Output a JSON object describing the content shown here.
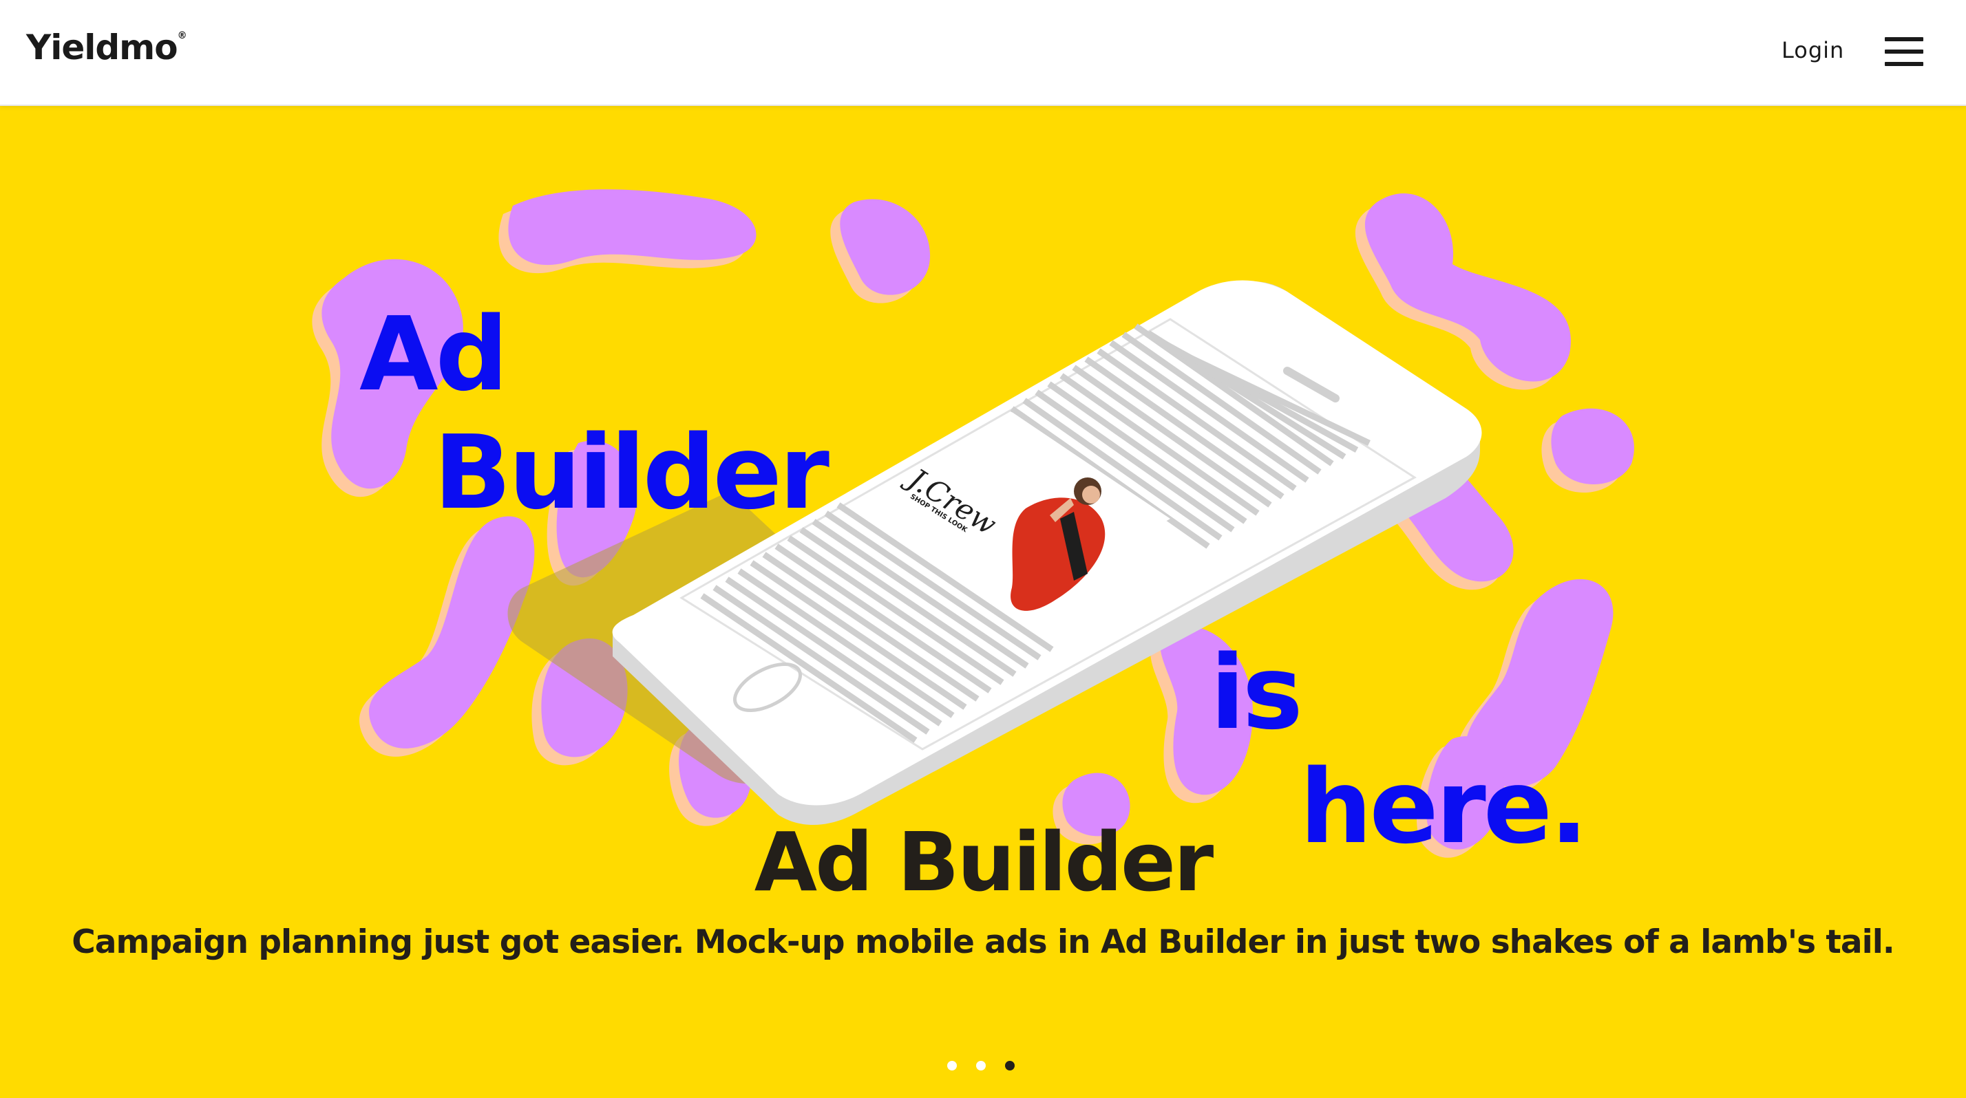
{
  "header": {
    "logo": "Yieldmo",
    "logo_mark": "®",
    "login_label": "Login",
    "menu_icon": "hamburger-menu-icon"
  },
  "hero": {
    "background_color": "#ffdb00",
    "art": {
      "line1": "Ad",
      "line2": "Builder",
      "line3": "is",
      "line4": "here.",
      "phone_ad_brand": "J.Crew",
      "phone_ad_cta": "SHOP THIS LOOK",
      "accent_color": "#0b0df2",
      "blob_color": "#d98aff"
    },
    "title": "Ad Builder",
    "subtitle": "Campaign planning just got easier. Mock-up mobile ads in Ad Builder in just two shakes of a lamb's tail."
  },
  "carousel": {
    "slide_count": 3,
    "active_index": 2
  }
}
